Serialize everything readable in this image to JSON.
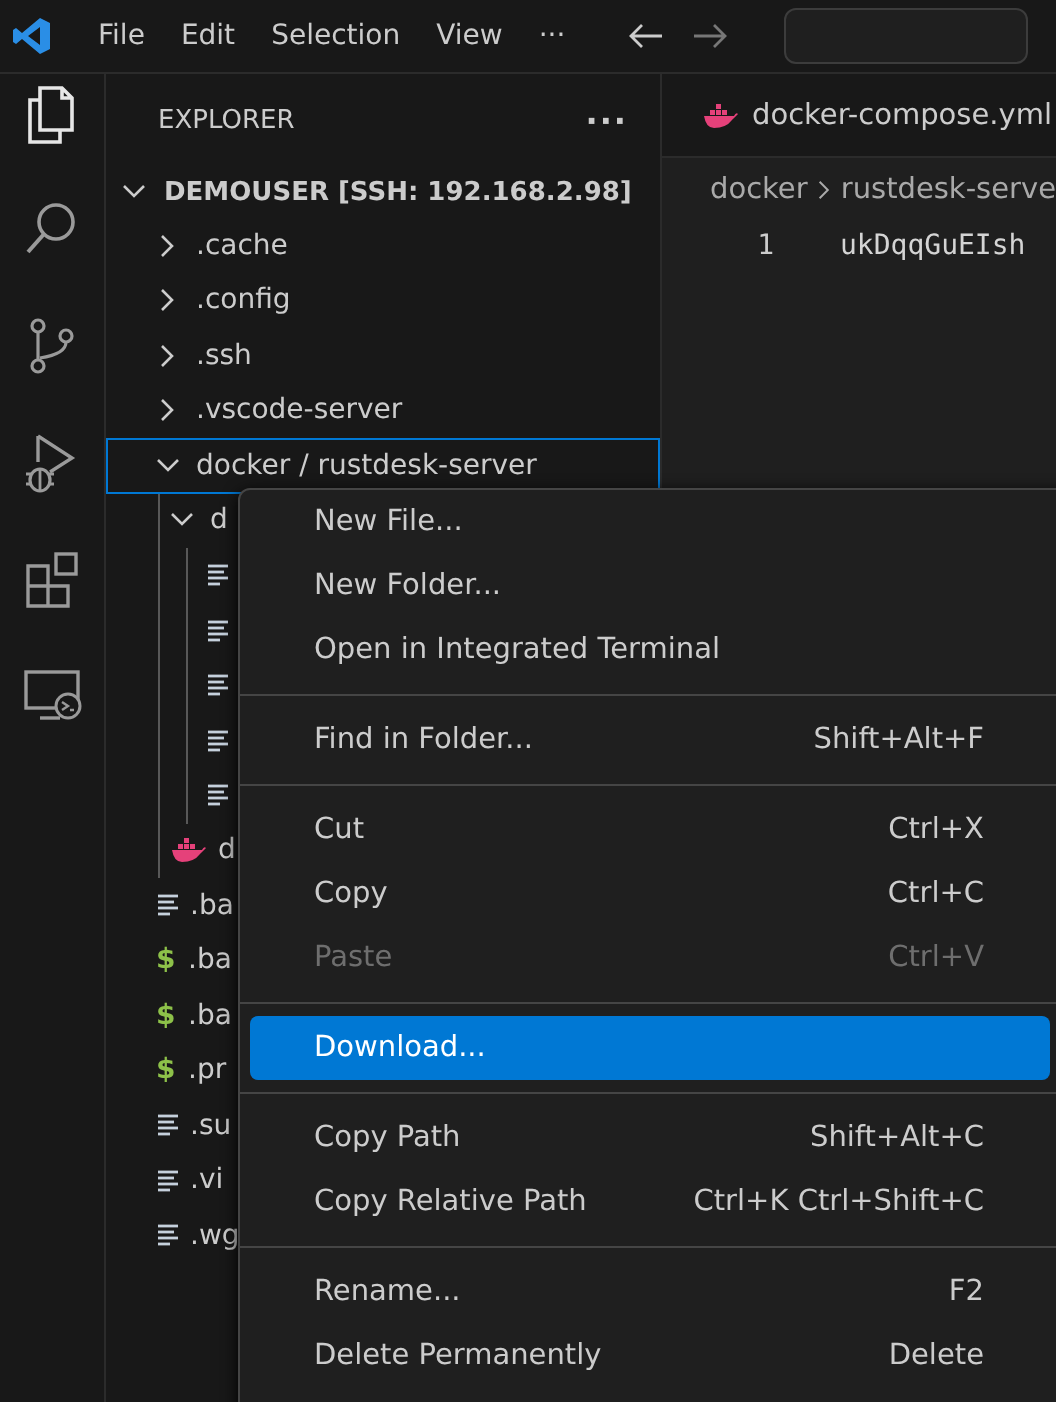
{
  "menu_bar": {
    "items": [
      "File",
      "Edit",
      "Selection",
      "View",
      "···"
    ]
  },
  "activity_bar": {
    "items": [
      {
        "kind": "explorer",
        "selected": true
      },
      {
        "kind": "search",
        "selected": false
      },
      {
        "kind": "source-control",
        "selected": false
      },
      {
        "kind": "run-debug",
        "selected": false
      },
      {
        "kind": "extensions",
        "selected": false
      },
      {
        "kind": "remote",
        "selected": false
      }
    ]
  },
  "explorer": {
    "title": "EXPLORER",
    "more": "···",
    "root": {
      "label": "DEMOUSER [SSH: 192.168.2.98]",
      "expanded": true
    },
    "tree": [
      {
        "label": ".cache",
        "kind": "folder",
        "expanded": false,
        "focused": false
      },
      {
        "label": ".config",
        "kind": "folder",
        "expanded": false,
        "focused": false
      },
      {
        "label": ".ssh",
        "kind": "folder",
        "expanded": false,
        "focused": false
      },
      {
        "label": ".vscode-server",
        "kind": "folder",
        "expanded": false,
        "focused": false
      },
      {
        "label": "docker / rustdesk-server",
        "kind": "folder",
        "expanded": true,
        "focused": true,
        "children": [
          {
            "label": "d",
            "kind": "folder",
            "expanded": true,
            "focused": false,
            "children": [
              {
                "kind": "file",
                "focused": false
              },
              {
                "kind": "file",
                "focused": false
              },
              {
                "kind": "file",
                "focused": false
              },
              {
                "kind": "file",
                "focused": false
              },
              {
                "kind": "file",
                "focused": false
              }
            ]
          },
          {
            "label": "d",
            "kind": "docker",
            "focused": false
          }
        ]
      },
      {
        "label": ".ba",
        "kind": "file",
        "focused": false
      },
      {
        "label": ".ba",
        "kind": "shell",
        "icon": "$",
        "focused": false
      },
      {
        "label": ".ba",
        "kind": "shell",
        "icon": "$",
        "focused": false
      },
      {
        "label": ".pr",
        "kind": "shell",
        "icon": "$",
        "focused": false
      },
      {
        "label": ".su",
        "kind": "file",
        "focused": false
      },
      {
        "label": ".vi",
        "kind": "file",
        "focused": false
      },
      {
        "label": ".wg",
        "kind": "file",
        "focused": false
      }
    ]
  },
  "editor": {
    "tab": {
      "label": "docker-compose.yml"
    },
    "breadcrumb": [
      "docker",
      "rustdesk-serve"
    ],
    "lines": [
      {
        "number": "1",
        "text": "ukDqqGuEIsh"
      }
    ]
  },
  "context_menu": {
    "groups": [
      [
        {
          "label": "New File...",
          "disabled": false,
          "selected": false
        },
        {
          "label": "New Folder...",
          "disabled": false,
          "selected": false
        },
        {
          "label": "Open in Integrated Terminal",
          "disabled": false,
          "selected": false
        }
      ],
      [
        {
          "label": "Find in Folder...",
          "shortcut": "Shift+Alt+F",
          "disabled": false,
          "selected": false
        }
      ],
      [
        {
          "label": "Cut",
          "shortcut": "Ctrl+X",
          "disabled": false,
          "selected": false
        },
        {
          "label": "Copy",
          "shortcut": "Ctrl+C",
          "disabled": false,
          "selected": false
        },
        {
          "label": "Paste",
          "shortcut": "Ctrl+V",
          "disabled": true,
          "selected": false
        }
      ],
      [
        {
          "label": "Download...",
          "disabled": false,
          "selected": true
        }
      ],
      [
        {
          "label": "Copy Path",
          "shortcut": "Shift+Alt+C",
          "disabled": false,
          "selected": false
        },
        {
          "label": "Copy Relative Path",
          "shortcut": "Ctrl+K Ctrl+Shift+C",
          "disabled": false,
          "selected": false
        }
      ],
      [
        {
          "label": "Rename...",
          "shortcut": "F2",
          "disabled": false,
          "selected": false
        },
        {
          "label": "Delete Permanently",
          "shortcut": "Delete",
          "disabled": false,
          "selected": false
        }
      ]
    ]
  }
}
